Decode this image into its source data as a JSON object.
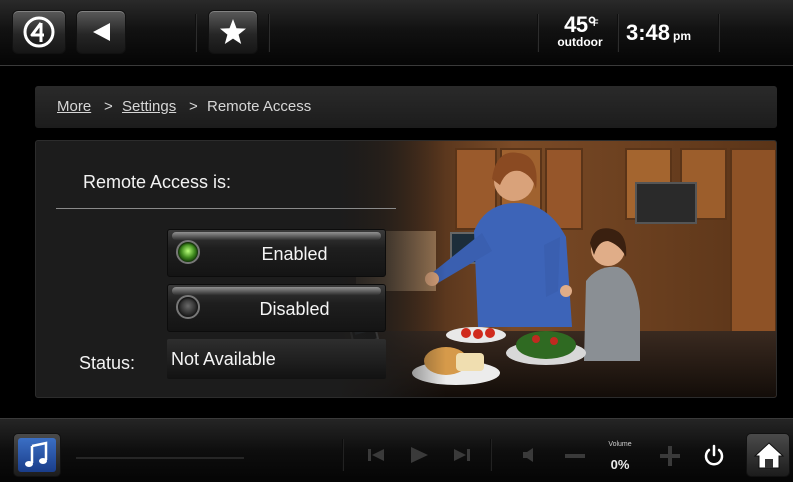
{
  "header": {
    "temperature": "45°",
    "temperature_unit": "F",
    "temperature_label": "outdoor",
    "time": "3:48",
    "ampm": "pm"
  },
  "breadcrumb": {
    "items": [
      "More",
      "Settings",
      "Remote Access"
    ],
    "separator": ">"
  },
  "remote_access": {
    "title": "Remote Access is:",
    "options": [
      {
        "label": "Enabled",
        "selected": true
      },
      {
        "label": "Disabled",
        "selected": false
      }
    ],
    "status_label": "Status:",
    "status_value": "Not Available"
  },
  "footer": {
    "volume_label": "Volume",
    "volume_value": "0%"
  },
  "icons": {
    "logo": "control4-logo-icon",
    "back": "back-arrow-icon",
    "favorites": "star-icon",
    "music": "music-note-icon",
    "home": "home-icon",
    "power": "power-icon"
  },
  "colors": {
    "indicator_on": "#6ee33a",
    "music_button": "#2f5fb4"
  }
}
